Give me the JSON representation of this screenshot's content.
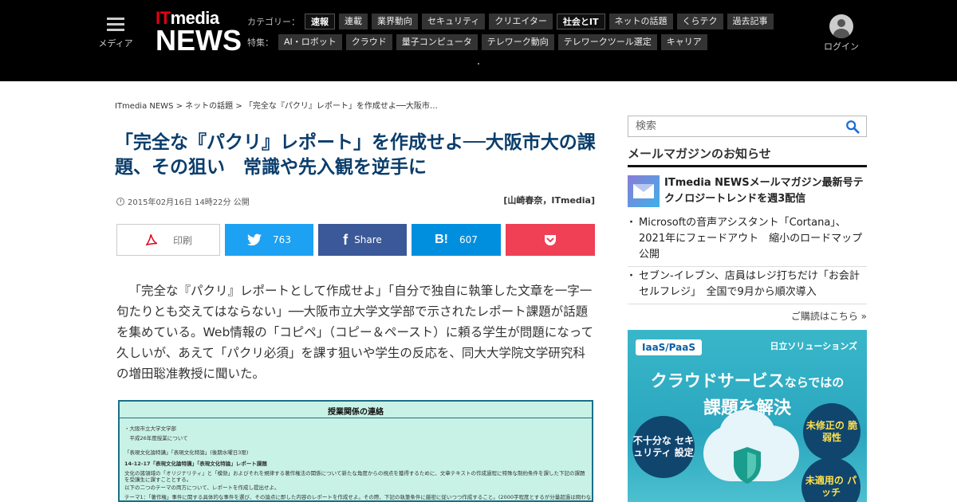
{
  "header": {
    "media_label": "メディア",
    "logo_top": "ITmedia",
    "logo_top_it": "IT",
    "logo_top_rest": "media",
    "logo_bottom": "NEWS",
    "category_label": "カテゴリー：",
    "categories": [
      {
        "label": "速報",
        "active": true
      },
      {
        "label": "連載",
        "active": false
      },
      {
        "label": "業界動向",
        "active": false
      },
      {
        "label": "セキュリティ",
        "active": false
      },
      {
        "label": "クリエイター",
        "active": false
      },
      {
        "label": "社会とIT",
        "active": true
      },
      {
        "label": "ネットの話題",
        "active": false
      },
      {
        "label": "くらテク",
        "active": false
      },
      {
        "label": "過去記事",
        "active": false
      }
    ],
    "feature_label": "特集：",
    "features": [
      "AI・ロボット",
      "クラウド",
      "量子コンピュータ",
      "テレワーク動向",
      "テレワークツール選定",
      "キャリア"
    ],
    "login_label": "ログイン"
  },
  "article": {
    "breadcrumb": "ITmedia NEWS > ネットの話題 > 「完全な『パクリ』レポート」を作成せよ──大阪市…",
    "title": "「完全な『パクリ』レポート」を作成せよ──大阪市大の課題、その狙い　常識や先入観を逆手に",
    "date": "2015年02月16日 14時22分 公開",
    "author": "[山崎春奈，ITmedia]",
    "share": {
      "print": "印刷",
      "twitter": "763",
      "facebook": "Share",
      "hatena_icon": "B!",
      "hatena": "607"
    },
    "body": "「完全な『パクリ』レポートとして作成せよ」「自分で独自に執筆した文章を一字一句たりとも交えてはならない」──大阪市立大学文学部で示されたレポート課題が話題を集めている。Web情報の「コピペ」（コピー＆ペースト）に頼る学生が問題になって久しいが、あえて「パクリ必須」を課す狙いや学生の反応を、同大大学院文学研究科の増田聡准教授に聞いた。",
    "doc": {
      "title": "授業関係の連絡",
      "lines": [
        "・大阪市立大学文学部",
        "　平成26年度授業について",
        "「表現文化論特講」「表現文化特論」(後期水曜日3限)",
        "14-12-17「表現文化論特講」「表現文化特論」レポート課題",
        "文化の諸領域の「オリジナリティ」と「模倣」およびそれを規律する著作権法の関係について新たな角度からの視点を獲得するために、文章テキストの作成過程に特殊な制約条件を課した下記の課題を受講生に課すこととする。",
        "以下の二つのテーマの両方について、レポートを作成し提出せよ。",
        "テーマ1：「著作権」事件に関する具体的な事件を選び、その論点に即した内容のレポートを作成せよ。その際、下記の執筆条件に厳密に従いつつ作成すること。(2000字程度とするが分量超過は問わない)"
      ]
    }
  },
  "sidebar": {
    "search_placeholder": "検索",
    "mm_heading": "メールマガジンのお知らせ",
    "mm_feature": "ITmedia NEWSメールマガジン最新号テクノロジートレンドを週3配信",
    "mm_items": [
      "Microsoftの音声アシスタント「Cortana」、2021年にフェードアウト　縮小のロードマップ公開",
      "セブン-イレブン、店員はレジ打ちだけ「お会計セルフレジ」　全国で9月から順次導入"
    ],
    "subscribe": "ご購読はこちら »",
    "ad": {
      "tag": "IaaS/PaaS",
      "brand": "日立ソリューションズ",
      "headline1": "クラウドサービスならではの",
      "headline1_big": "クラウドサービス",
      "headline1_small": "ならではの",
      "headline2": "課題を解決",
      "bubble1": "不十分な セキュリティ 設定",
      "bubble2": "未修正の 脆弱性",
      "bubble3": "未適用の パッチ"
    }
  },
  "colors": {
    "header_bg": "#000000",
    "title_color": "#0a3d6b",
    "twitter": "#1da1f2",
    "facebook": "#3b5998",
    "hatena": "#008fde",
    "pocket": "#ef4056"
  }
}
